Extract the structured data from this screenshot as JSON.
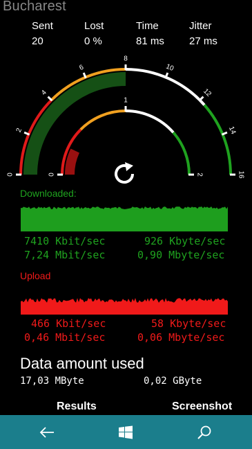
{
  "header": {
    "title": "Bucharest"
  },
  "stats": [
    {
      "label": "Sent",
      "value": "20"
    },
    {
      "label": "Lost",
      "value": "0 %"
    },
    {
      "label": "Time",
      "value": "81 ms"
    },
    {
      "label": "Jitter",
      "value": "27 ms"
    }
  ],
  "outer_gauge": {
    "ticks": [
      "0",
      "2",
      "4",
      "6",
      "8",
      "10",
      "12",
      "14",
      "16"
    ],
    "fill_level": 8
  },
  "inner_gauge": {
    "ticks": [
      "0",
      "1",
      "2"
    ],
    "fill_level": 0.28
  },
  "download": {
    "label": "Downloaded:",
    "kbit": "7410 Kbit/sec",
    "kbyte": "926 Kbyte/sec",
    "mbit": "7,24 Mbit/sec",
    "mbyte": "0,90 Mbyte/sec"
  },
  "upload": {
    "label": "Upload",
    "kbit": "466 Kbit/sec",
    "kbyte": "58 Kbyte/sec",
    "mbit": "0,46 Mbit/sec",
    "mbyte": "0,06 Mbyte/sec"
  },
  "data_amount": {
    "title": "Data amount used",
    "mbyte": "17,03 MByte",
    "gbyte": "0,02 GByte"
  },
  "tabs": {
    "results": "Results",
    "screenshot": "Screenshot"
  },
  "colors": {
    "green": "#1fa21f",
    "red": "#f01a1a",
    "orange": "#f0a020",
    "nav": "#1b7e8c"
  },
  "icons": {
    "back": "back-arrow-icon",
    "home": "windows-logo-icon",
    "search": "search-icon",
    "refresh": "refresh-icon"
  }
}
